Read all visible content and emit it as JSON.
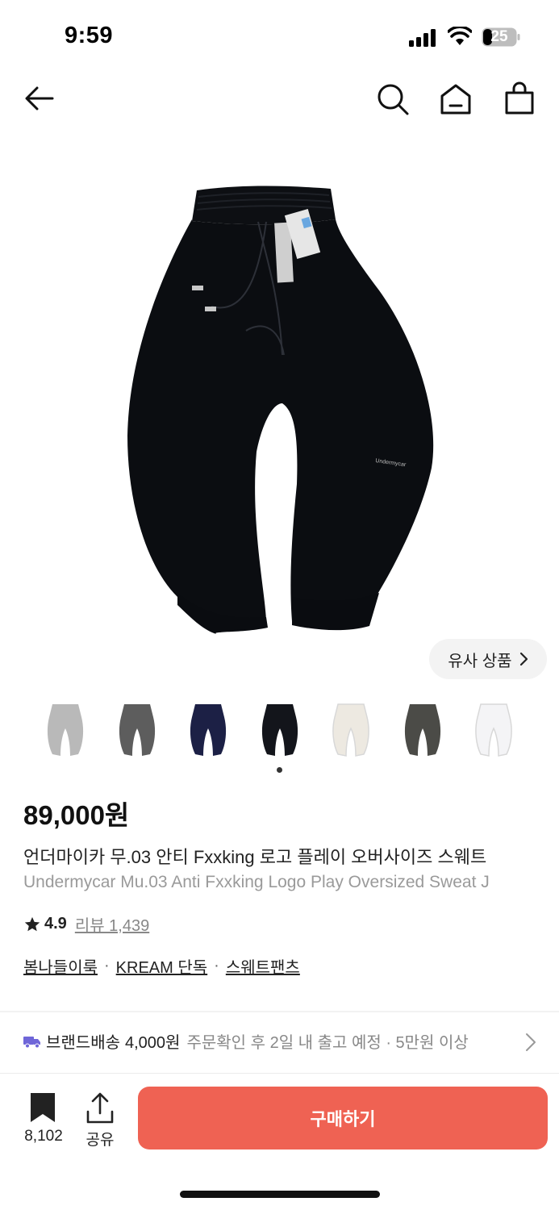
{
  "status": {
    "time": "9:59",
    "battery": "25"
  },
  "nav": {
    "back": "back-arrow",
    "icons": [
      "search-icon",
      "home-icon",
      "shopping-bag-icon"
    ]
  },
  "similar": {
    "label": "유사 상품"
  },
  "thumbnails": [
    {
      "color": "#b9b9b9"
    },
    {
      "color": "#5d5d5d"
    },
    {
      "color": "#1c2045"
    },
    {
      "color": "#13151b"
    },
    {
      "color": "#ede9e1"
    },
    {
      "color": "#4b4b47"
    },
    {
      "color": "#f4f4f6"
    }
  ],
  "product": {
    "price": "89,000원",
    "title_ko": "언더마이카 무.03 안티 Fxxking 로고 플레이 오버사이즈 스웨트",
    "title_en": "Undermycar Mu.03 Anti Fxxking Logo Play Oversized Sweat J",
    "rating": "4.9",
    "review_label": "리뷰 1,439",
    "tags": [
      "봄나들이룩",
      "KREAM 단독",
      "스웨트팬츠"
    ],
    "tag_separator": "·"
  },
  "shipping": {
    "label": "브랜드배송",
    "price": "4,000원",
    "detail": "주문확인 후 2일 내 출고 예정 · 5만원 이상"
  },
  "bottom": {
    "bookmark_count": "8,102",
    "share_label": "공유",
    "buy_label": "구매하기"
  },
  "colors": {
    "accent": "#ef6253"
  }
}
